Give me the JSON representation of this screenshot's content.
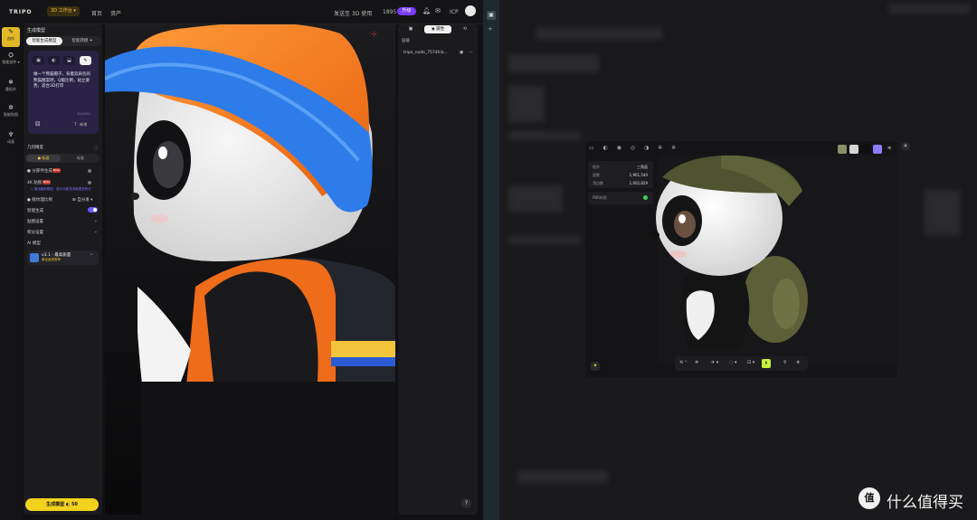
{
  "topbar": {
    "logo": "TRIPO",
    "workspace": "3D 工作台 ▾",
    "nav_home": "首页",
    "nav_assets": "资产",
    "promo": "发送至 3D 使用",
    "credits": "1895",
    "upgrade": "升级",
    "icp": "ICP"
  },
  "rail": {
    "items": [
      {
        "label": "创作",
        "icon": "✎"
      },
      {
        "label": "智能部件 ▾",
        "icon": "⛭"
      },
      {
        "label": "重拓扑",
        "icon": "❄"
      },
      {
        "label": "智能贴图",
        "icon": "✲"
      },
      {
        "label": "动画",
        "icon": "♆"
      }
    ]
  },
  "panel": {
    "title": "生成模型",
    "tab_generate": "智能生成模型",
    "tab_smart": "智能转模 ✦",
    "modes": [
      "▣",
      "◐",
      "⬓",
      "✎"
    ],
    "prompt": "做一个熊猫帽子，背着双肩包的熊猫图案吧，Q版比例，站立姿势，适合3D打印",
    "char_count": "32/1024",
    "lang": "T · 新增",
    "geometry_label": "几何精度",
    "geometry_tabs": [
      "● 标准",
      "标准"
    ],
    "options": [
      {
        "label": "● 分部件生成",
        "badge": "Beta"
      },
      {
        "label": "4K 贴图",
        "badge": "Beta"
      },
      {
        "label": "● 赋纹理比例",
        "extra": "⊞ 自分发 ▾"
      }
    ],
    "hint": "◇ 使用最新模型，部分功能将消耗更多积分",
    "rows": [
      "智能生成",
      "贴图设置",
      "积分设置"
    ],
    "ai_model_label": "AI 模型",
    "model_name": "v3.1 - 最高质量",
    "model_sub": "最佳画质推荐",
    "generate_btn": "生成模型 ◐ 50"
  },
  "layers": {
    "header": "层级",
    "tab_props": "◉ 属性",
    "item": "tripo_node_7574fcb...",
    "eye": "◉",
    "more": "⋯",
    "help": "?"
  },
  "strip": {
    "tab_icon": "▣",
    "plus": "+"
  },
  "modal": {
    "tools": "▭ ◐ ◉ ◎ ◑ ✲ ✲",
    "info_rows": [
      {
        "label": "拓扑",
        "value": "三角面"
      },
      {
        "label": "面数",
        "value": "1,961,540"
      },
      {
        "label": "顶点数",
        "value": "1,002,829"
      }
    ],
    "pbr_label": "PBR材质",
    "close": "×",
    "toolbar": [
      "⟲ ⁺",
      "✲",
      "✈ ▾",
      "◌ ▾",
      "⊡ ▾",
      "⇞",
      "⚲",
      "✵"
    ],
    "corner": "✦",
    "swatches": [
      "#8a8f6a",
      "#d5d5d5",
      "#101010",
      "#8a7dff"
    ]
  },
  "watermark": {
    "logo": "值",
    "text": "什么值得买"
  }
}
